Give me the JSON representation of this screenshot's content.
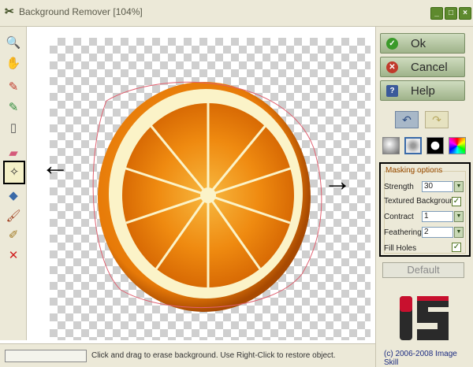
{
  "window": {
    "title": "Background Remover [104%]",
    "app_icon_glyph": "✂"
  },
  "toolbar": {
    "tools": [
      {
        "name": "zoom-tool",
        "icon": "zoom-icon",
        "glyph": "🔍",
        "color": "#333333"
      },
      {
        "name": "pan-tool",
        "icon": "hand-icon",
        "glyph": "✋",
        "color": "#333333"
      },
      {
        "name": "erase-marker-tool",
        "icon": "red-marker-icon",
        "glyph": "✎",
        "color": "#c0392b"
      },
      {
        "name": "restore-marker-tool",
        "icon": "green-marker-icon",
        "glyph": "✎",
        "color": "#2e8b3a"
      },
      {
        "name": "new-document-tool",
        "icon": "page-icon",
        "glyph": "▯",
        "color": "#555555"
      },
      {
        "name": "eraser-tool",
        "icon": "eraser-icon",
        "glyph": "▰",
        "color": "#d45a7a"
      },
      {
        "name": "magic-wand-tool",
        "icon": "magic-wand-icon",
        "glyph": "✧",
        "color": "#333333",
        "active": true
      },
      {
        "name": "fill-tool",
        "icon": "paint-bucket-icon",
        "glyph": "◆",
        "color": "#3a6aa8"
      },
      {
        "name": "brush-tool",
        "icon": "brush-icon",
        "glyph": "🖌",
        "color": "#a04020"
      },
      {
        "name": "broom-tool",
        "icon": "broom-icon",
        "glyph": "✐",
        "color": "#a07820"
      },
      {
        "name": "delete-tool",
        "icon": "red-x-icon",
        "glyph": "✕",
        "color": "#d02020"
      }
    ],
    "settings_icon": "gear-icon"
  },
  "buttons": {
    "ok": "Ok",
    "cancel": "Cancel",
    "help": "Help",
    "default": "Default"
  },
  "history": {
    "undo_icon": "undo-icon",
    "redo_icon": "redo-icon"
  },
  "mode_icons": [
    "sphere-mode-icon",
    "soft-mode-icon",
    "circle-mode-icon",
    "color-wheel-icon"
  ],
  "masking_options": {
    "legend": "Masking options",
    "strength_label": "Strength",
    "strength_value": "30",
    "textured_label": "Textured Background",
    "textured_checked": true,
    "contract_label": "Contract",
    "contract_value": "1",
    "feathering_label": "Feathering",
    "feathering_value": "2",
    "fill_holes_label": "Fill Holes",
    "fill_holes_checked": true
  },
  "status": {
    "text": "Click and drag to erase background. Use Right-Click to restore object."
  },
  "footer": {
    "copyright": "(c) 2006-2008 Image Skill"
  },
  "colors": {
    "accent_green": "#5e8a2e",
    "ok_icon": "#3a9a2a",
    "cancel_icon": "#c0392b",
    "help_icon": "#3a5a9a"
  }
}
